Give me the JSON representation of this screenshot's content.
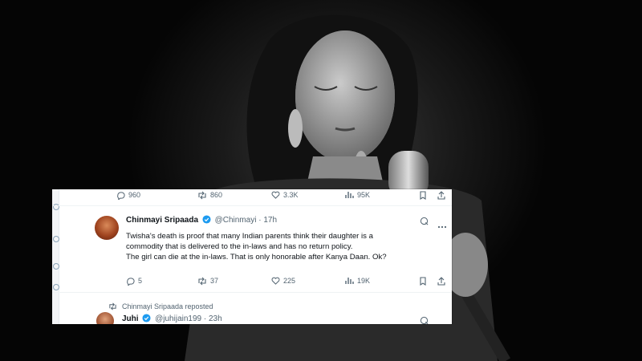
{
  "top_row": {
    "replies": "960",
    "reposts": "860",
    "likes": "3.3K",
    "views": "95K"
  },
  "tweet": {
    "name": "Chinmayi Sripaada",
    "handle": "@Chinmayi",
    "time": "· 17h",
    "lines": [
      "Twisha's death is proof that many Indian parents think their daughter is a",
      "commodity that is delivered to the in-laws and has no return policy.",
      "The girl can die at the in-laws. That is only honorable after Kanya Daan. Ok?"
    ],
    "replies": "5",
    "reposts": "37",
    "likes": "225",
    "views": "19K"
  },
  "repost_note": "Chinmayi Sripaada reposted",
  "next_tweet": {
    "name": "Juhi",
    "handle": "@juhijain199",
    "time": "· 23h"
  },
  "icons": [
    "reply-icon",
    "repost-icon",
    "like-icon",
    "views-icon",
    "bookmark-icon",
    "share-icon",
    "grok-icon",
    "more-icon",
    "verified-icon"
  ],
  "colors": {
    "verified": "#1d9bf0",
    "text": "#0f1419",
    "muted": "#536471"
  }
}
